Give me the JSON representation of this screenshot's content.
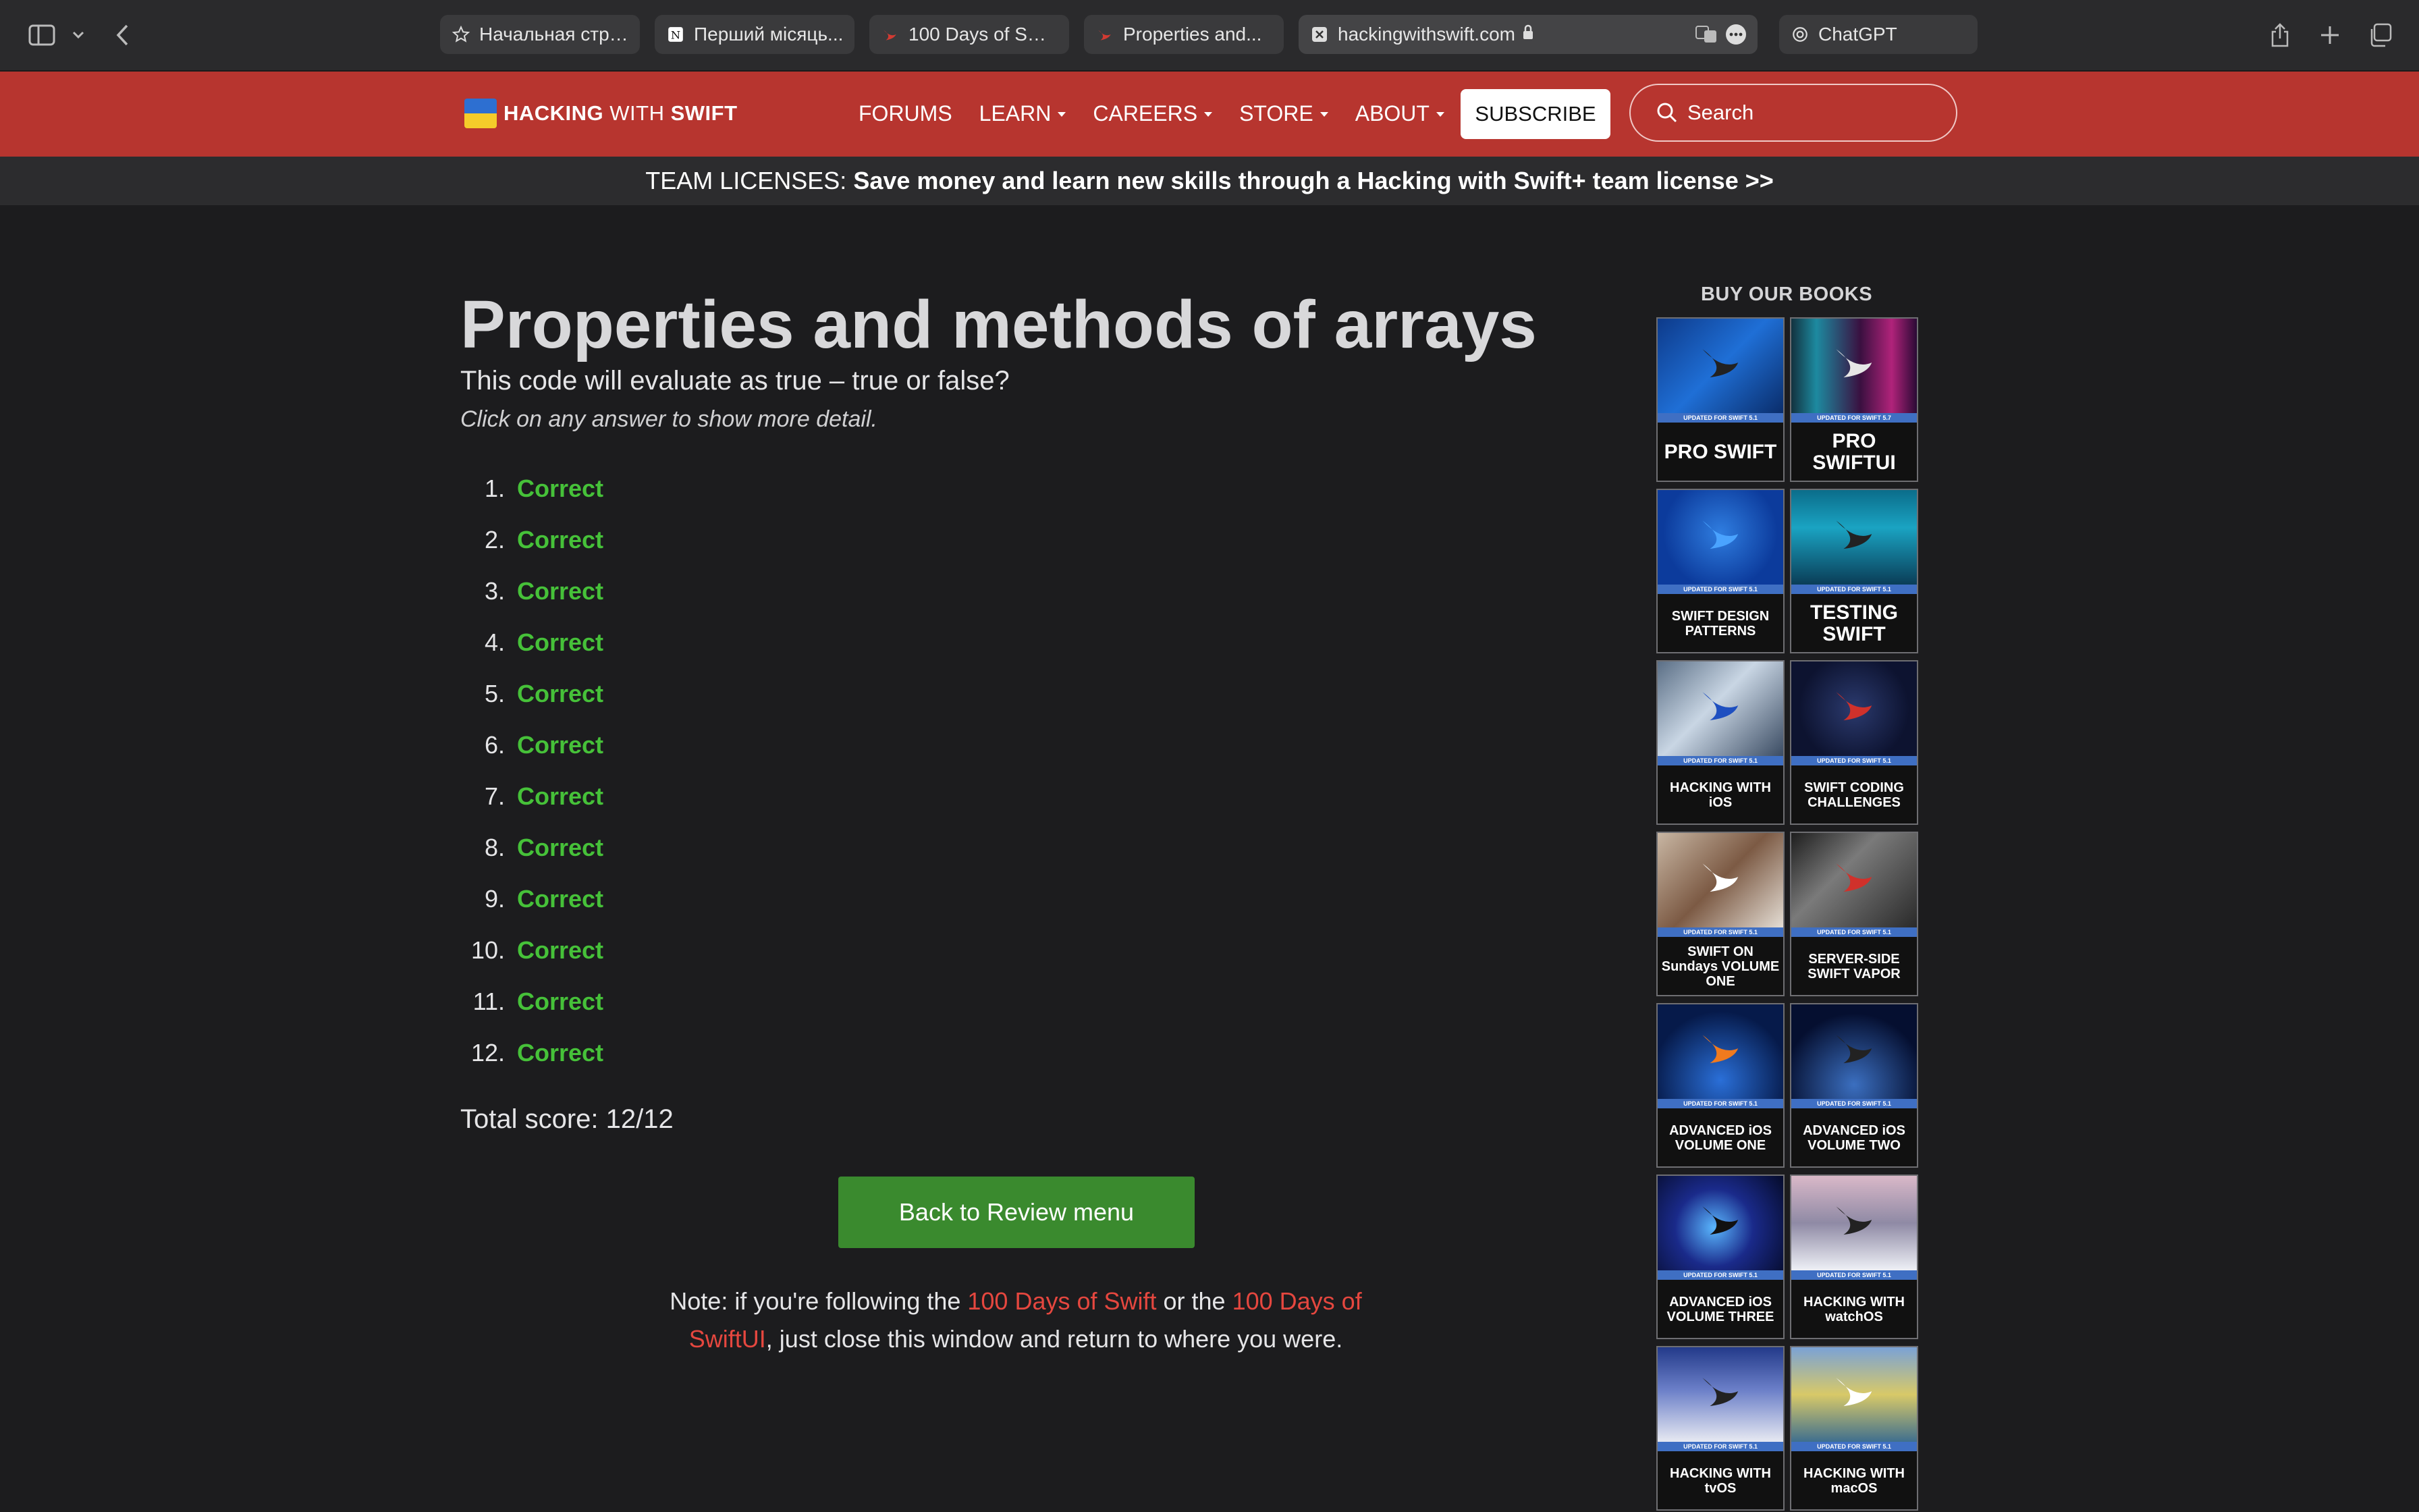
{
  "browser": {
    "tabs": [
      {
        "label": "Начальная стра...",
        "icon": "star-icon"
      },
      {
        "label": "Перший місяць...",
        "icon": "notion-icon"
      },
      {
        "label": "100 Days of Swi...",
        "icon": "swift-icon"
      },
      {
        "label": "Properties and...",
        "icon": "swift-icon"
      },
      {
        "label": "hackingwithswift.com",
        "icon": "close-icon",
        "secure": true
      },
      {
        "label": "ChatGPT",
        "icon": "chatgpt-icon"
      }
    ]
  },
  "site": {
    "logo_bold": "HACKING",
    "logo_mid": "WITH",
    "logo_end": "SWIFT",
    "nav": [
      "FORUMS",
      "LEARN",
      "CAREERS",
      "STORE",
      "ABOUT"
    ],
    "subscribe_label": "SUBSCRIBE",
    "search_placeholder": "Search",
    "accent": "#b7352f"
  },
  "promo": {
    "prefix": "TEAM LICENSES:",
    "text": "Save money and learn new skills through a Hacking with Swift+ team license >>"
  },
  "main": {
    "title": "Properties and methods of arrays",
    "question": "This code will evaluate as true – true or false?",
    "hint": "Click on any answer to show more detail.",
    "answers": [
      {
        "num": "1.",
        "result": "Correct"
      },
      {
        "num": "2.",
        "result": "Correct"
      },
      {
        "num": "3.",
        "result": "Correct"
      },
      {
        "num": "4.",
        "result": "Correct"
      },
      {
        "num": "5.",
        "result": "Correct"
      },
      {
        "num": "6.",
        "result": "Correct"
      },
      {
        "num": "7.",
        "result": "Correct"
      },
      {
        "num": "8.",
        "result": "Correct"
      },
      {
        "num": "9.",
        "result": "Correct"
      },
      {
        "num": "10.",
        "result": "Correct"
      },
      {
        "num": "11.",
        "result": "Correct"
      },
      {
        "num": "12.",
        "result": "Correct"
      }
    ],
    "score": "Total score: 12/12",
    "back_label": "Back to Review menu",
    "note_prefix": "Note: if you're following the ",
    "note_link1": "100 Days of Swift",
    "note_mid": " or the ",
    "note_link2": "100 Days of SwiftUI",
    "note_suffix": ", just close this window and return to where you were.",
    "correct_color": "#46c139"
  },
  "books": {
    "heading": "BUY OUR BOOKS",
    "items": [
      {
        "title": "PRO SWIFT",
        "strip": "UPDATED FOR SWIFT 5.1"
      },
      {
        "title": "PRO SWIFTUI",
        "strip": "UPDATED FOR SWIFT 5.7"
      },
      {
        "title": "SWIFT DESIGN PATTERNS",
        "strip": "UPDATED FOR SWIFT 5.1"
      },
      {
        "title": "TESTING SWIFT",
        "strip": "UPDATED FOR SWIFT 5.1"
      },
      {
        "title": "HACKING WITH iOS",
        "strip": "UPDATED FOR SWIFT 5.1"
      },
      {
        "title": "SWIFT CODING CHALLENGES",
        "strip": "UPDATED FOR SWIFT 5.1"
      },
      {
        "title": "SWIFT ON Sundays VOLUME ONE",
        "strip": "UPDATED FOR SWIFT 5.1"
      },
      {
        "title": "SERVER-SIDE SWIFT VAPOR",
        "strip": "UPDATED FOR SWIFT 5.1"
      },
      {
        "title": "ADVANCED iOS VOLUME ONE",
        "strip": "UPDATED FOR SWIFT 5.1"
      },
      {
        "title": "ADVANCED iOS VOLUME TWO",
        "strip": "UPDATED FOR SWIFT 5.1"
      },
      {
        "title": "ADVANCED iOS VOLUME THREE",
        "strip": "UPDATED FOR SWIFT 5.1"
      },
      {
        "title": "HACKING WITH watchOS",
        "strip": "UPDATED FOR SWIFT 5.1"
      },
      {
        "title": "HACKING WITH tvOS",
        "strip": "UPDATED FOR SWIFT 5.1"
      },
      {
        "title": "HACKING WITH macOS",
        "strip": "UPDATED FOR SWIFT 5.1"
      }
    ]
  }
}
